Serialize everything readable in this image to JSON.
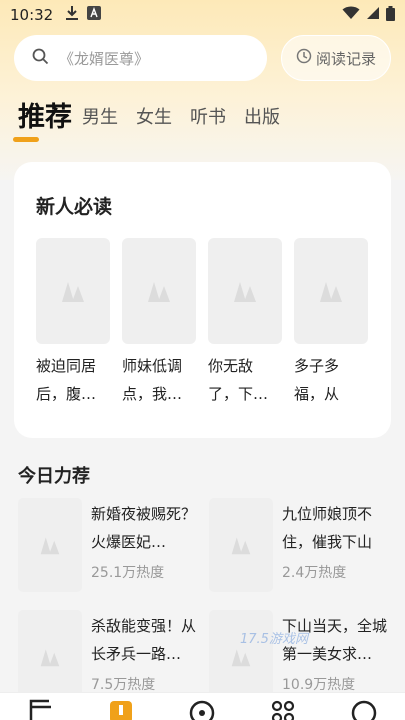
{
  "status_bar": {
    "time": "10:32"
  },
  "search": {
    "placeholder": "《龙婿医尊》",
    "history_label": "阅读记录"
  },
  "tabs": [
    {
      "label": "推荐",
      "active": true
    },
    {
      "label": "男生"
    },
    {
      "label": "女生"
    },
    {
      "label": "听书"
    },
    {
      "label": "出版"
    }
  ],
  "new_readers": {
    "title": "新人必读",
    "books": [
      {
        "title": "被迫同居后，腹…"
      },
      {
        "title": "师妹低调点，我…"
      },
      {
        "title": "你无敌了，下…"
      },
      {
        "title": "多子多福，从娶…"
      }
    ]
  },
  "today": {
    "title": "今日力荐",
    "items": [
      {
        "title": "新婚夜被赐死？火爆医妃…",
        "heat": "25.1万热度"
      },
      {
        "title": "九位师娘顶不住，催我下山",
        "heat": "2.4万热度"
      },
      {
        "title": "杀敌能变强！从长矛兵一路…",
        "heat": "7.5万热度"
      },
      {
        "title": "下山当天，全城第一美女求…",
        "heat": "10.9万热度"
      }
    ]
  },
  "watermark": "17.5游戏网",
  "colors": {
    "accent": "#f0a11a",
    "header_bg": "#fde9b8"
  },
  "icons": {
    "search": "search-icon",
    "history": "clock-icon",
    "cover": "book-placeholder-icon",
    "nav": [
      "bookshelf-icon",
      "bookstore-icon",
      "discover-icon",
      "category-icon",
      "profile-icon"
    ]
  }
}
